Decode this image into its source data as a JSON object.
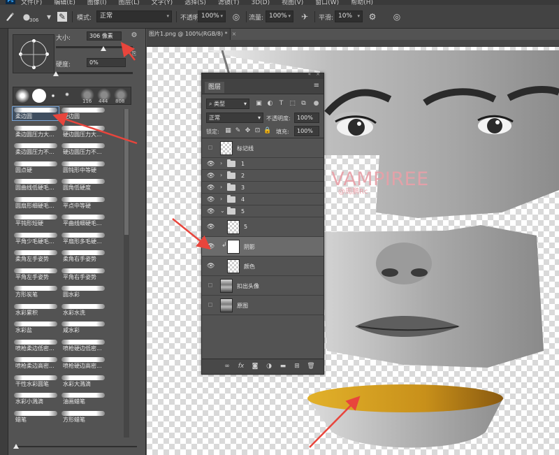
{
  "app": {
    "logo": "Ps",
    "menu": [
      "文件(F)",
      "编辑(E)",
      "图像(I)",
      "图层(L)",
      "文字(Y)",
      "选择(S)",
      "滤镜(T)",
      "3D(D)",
      "视图(V)",
      "窗口(W)",
      "帮助(H)"
    ]
  },
  "options": {
    "brush_size_small": "306",
    "mode_label": "模式:",
    "mode_value": "正常",
    "opacity_label": "不透明度:",
    "opacity_value": "100%",
    "flow_label": "流量:",
    "flow_value": "100%",
    "smoothing_label": "平滑:",
    "smoothing_value": "10%"
  },
  "brush_picker": {
    "size_label": "大小:",
    "size_value": "306 像素",
    "hardness_label": "硬度:",
    "hardness_value": "0%",
    "size_level": 0.62,
    "hardness_level": 0.0,
    "recent_sizes": [
      "116",
      "444",
      "808"
    ],
    "presets": [
      "柔边圆",
      "硬边圆",
      "柔边圆压力大...",
      "硬边圆压力大...",
      "柔边圆压力不...",
      "硬边圆压力不...",
      "圆点硬",
      "圆钝形中等硬",
      "圆曲线低硬毛...",
      "圆角低硬度",
      "圆扇形细硬毛...",
      "平点中等硬",
      "平钝形短硬",
      "平曲线细硬毛...",
      "平角少毛硬毛...",
      "平扇形多毛硬...",
      "柔角左手姿势",
      "柔角右手姿势",
      "平角左手姿势",
      "平角右手姿势",
      "方形炭笔",
      "圆水彩",
      "水彩累积",
      "水彩水洗",
      "水彩盐",
      "咸水彩",
      "喷枪柔边低密...",
      "喷枪硬边低密...",
      "喷枪柔边高密...",
      "喷枪硬边高密...",
      "干性水彩圆笔",
      "水彩大溅滴",
      "水彩小溅滴",
      "油画蜡笔",
      "蜡笔",
      "方形蜡笔"
    ]
  },
  "document": {
    "tab_label": "图片1.png @ 100%(RGB/8) *",
    "close_glyph": "×"
  },
  "watermark": {
    "main": "站酷 VAMPIREE",
    "sub": "@周鹏Rc"
  },
  "layers_panel": {
    "title": "图层",
    "filter_kind": "类型",
    "blend_mode": "正常",
    "opacity_label": "不透明度:",
    "opacity_value": "100%",
    "lock_label": "锁定:",
    "fill_label": "填充:",
    "fill_value": "100%",
    "layers": [
      {
        "name": "标记线",
        "visible": false,
        "type": "layer"
      },
      {
        "name": "1",
        "visible": true,
        "type": "group"
      },
      {
        "name": "2",
        "visible": true,
        "type": "group"
      },
      {
        "name": "3",
        "visible": true,
        "type": "group"
      },
      {
        "name": "4",
        "visible": true,
        "type": "group"
      },
      {
        "name": "5",
        "visible": true,
        "type": "group-open"
      },
      {
        "name": "5",
        "visible": true,
        "type": "layer"
      },
      {
        "name": "阴影",
        "visible": true,
        "type": "clipped-mask"
      },
      {
        "name": "颜色",
        "visible": true,
        "type": "layer"
      },
      {
        "name": "扣出头像",
        "visible": false,
        "type": "photo"
      },
      {
        "name": "原图",
        "visible": false,
        "type": "photo"
      }
    ]
  },
  "colors": {
    "annotation_arrow": "#e8453c",
    "shadow_fill": "#d9a31f",
    "panel_bg": "#535353"
  }
}
